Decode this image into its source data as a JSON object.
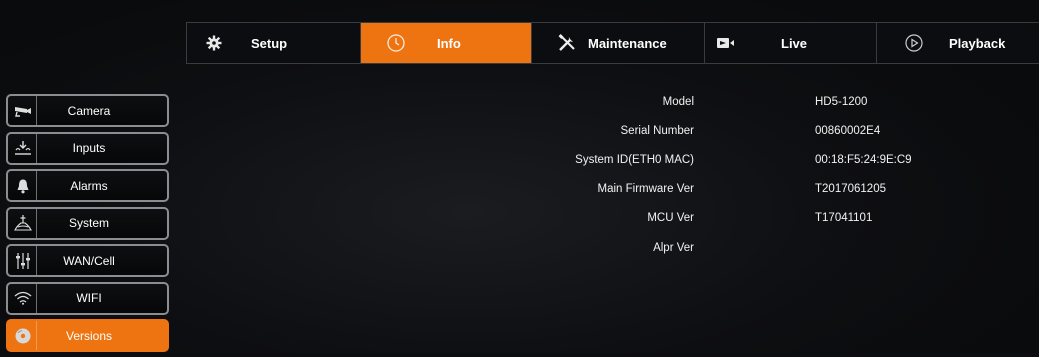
{
  "tabs": [
    {
      "label": "Setup",
      "icon": "gear-icon",
      "active": false
    },
    {
      "label": "Info",
      "icon": "clock-icon",
      "active": true
    },
    {
      "label": "Maintenance",
      "icon": "tools-icon",
      "active": false
    },
    {
      "label": "Live",
      "icon": "video-camera-icon",
      "active": false
    },
    {
      "label": "Playback",
      "icon": "play-circle-icon",
      "active": false
    }
  ],
  "sidebar": {
    "items": [
      {
        "label": "Camera",
        "icon": "camera-icon"
      },
      {
        "label": "Inputs",
        "icon": "inputs-icon"
      },
      {
        "label": "Alarms",
        "icon": "bell-icon"
      },
      {
        "label": "System",
        "icon": "system-icon"
      },
      {
        "label": "WAN/Cell",
        "icon": "sliders-icon"
      },
      {
        "label": "WIFI",
        "icon": "wifi-icon"
      },
      {
        "label": "Versions",
        "icon": "disc-icon",
        "active": true
      }
    ]
  },
  "info": {
    "rows": [
      {
        "label": "Model",
        "value": "HD5-1200"
      },
      {
        "label": "Serial Number",
        "value": "00860002E4"
      },
      {
        "label": "System ID(ETH0 MAC)",
        "value": "00:18:F5:24:9E:C9"
      },
      {
        "label": "Main Firmware Ver",
        "value": "T2017061205"
      },
      {
        "label": "MCU Ver",
        "value": "T17041101"
      },
      {
        "label": "Alpr Ver",
        "value": ""
      }
    ]
  },
  "colors": {
    "accent": "#ee7311",
    "background": "#0c0d10",
    "border": "#8c8d90"
  }
}
